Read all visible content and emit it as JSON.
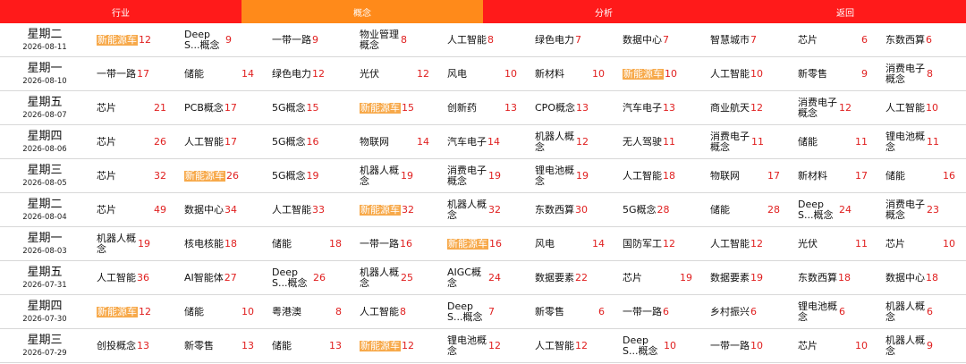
{
  "tabs": [
    {
      "label": "行业",
      "active": false
    },
    {
      "label": "概念",
      "active": true
    },
    {
      "label": "分析",
      "active": false
    },
    {
      "label": "返回",
      "active": false
    }
  ],
  "colors": {
    "tab_bg": "#ff1a1a",
    "tab_active": "#ff8a1a",
    "highlight": "#f7a94a",
    "count": "#e02020"
  },
  "rows": [
    {
      "weekday": "星期二",
      "date": "2026-08-11",
      "items": [
        {
          "name": "新能源车",
          "count": "12",
          "hl": true
        },
        {
          "name": "DeepS...概念",
          "count": "9"
        },
        {
          "name": "一带一路",
          "count": "9"
        },
        {
          "name": "物业管理概念",
          "count": "8"
        },
        {
          "name": "人工智能",
          "count": "8"
        },
        {
          "name": "绿色电力",
          "count": "7"
        },
        {
          "name": "数据中心",
          "count": "7"
        },
        {
          "name": "智慧城市",
          "count": "7"
        },
        {
          "name": "芯片",
          "count": "6"
        },
        {
          "name": "东数西算",
          "count": "6"
        }
      ]
    },
    {
      "weekday": "星期一",
      "date": "2026-08-10",
      "items": [
        {
          "name": "一带一路",
          "count": "17"
        },
        {
          "name": "储能",
          "count": "14"
        },
        {
          "name": "绿色电力",
          "count": "12"
        },
        {
          "name": "光伏",
          "count": "12"
        },
        {
          "name": "风电",
          "count": "10"
        },
        {
          "name": "新材料",
          "count": "10"
        },
        {
          "name": "新能源车",
          "count": "10",
          "hl": true
        },
        {
          "name": "人工智能",
          "count": "10"
        },
        {
          "name": "新零售",
          "count": "9"
        },
        {
          "name": "消费电子概念",
          "count": "8"
        }
      ]
    },
    {
      "weekday": "星期五",
      "date": "2026-08-07",
      "items": [
        {
          "name": "芯片",
          "count": "21"
        },
        {
          "name": "PCB概念",
          "count": "17"
        },
        {
          "name": "5G概念",
          "count": "15"
        },
        {
          "name": "新能源车",
          "count": "15",
          "hl": true
        },
        {
          "name": "创新药",
          "count": "13"
        },
        {
          "name": "CPO概念",
          "count": "13"
        },
        {
          "name": "汽车电子",
          "count": "13"
        },
        {
          "name": "商业航天",
          "count": "12"
        },
        {
          "name": "消费电子概念",
          "count": "12"
        },
        {
          "name": "人工智能",
          "count": "10"
        }
      ]
    },
    {
      "weekday": "星期四",
      "date": "2026-08-06",
      "items": [
        {
          "name": "芯片",
          "count": "26"
        },
        {
          "name": "人工智能",
          "count": "17"
        },
        {
          "name": "5G概念",
          "count": "16"
        },
        {
          "name": "物联网",
          "count": "14"
        },
        {
          "name": "汽车电子",
          "count": "14"
        },
        {
          "name": "机器人概念",
          "count": "12"
        },
        {
          "name": "无人驾驶",
          "count": "11"
        },
        {
          "name": "消费电子概念",
          "count": "11"
        },
        {
          "name": "储能",
          "count": "11"
        },
        {
          "name": "锂电池概念",
          "count": "11"
        }
      ]
    },
    {
      "weekday": "星期三",
      "date": "2026-08-05",
      "items": [
        {
          "name": "芯片",
          "count": "32"
        },
        {
          "name": "新能源车",
          "count": "26",
          "hl": true
        },
        {
          "name": "5G概念",
          "count": "19"
        },
        {
          "name": "机器人概念",
          "count": "19"
        },
        {
          "name": "消费电子概念",
          "count": "19"
        },
        {
          "name": "锂电池概念",
          "count": "19"
        },
        {
          "name": "人工智能",
          "count": "18"
        },
        {
          "name": "物联网",
          "count": "17"
        },
        {
          "name": "新材料",
          "count": "17"
        },
        {
          "name": "储能",
          "count": "16"
        }
      ]
    },
    {
      "weekday": "星期二",
      "date": "2026-08-04",
      "items": [
        {
          "name": "芯片",
          "count": "49"
        },
        {
          "name": "数据中心",
          "count": "34"
        },
        {
          "name": "人工智能",
          "count": "33"
        },
        {
          "name": "新能源车",
          "count": "32",
          "hl": true
        },
        {
          "name": "机器人概念",
          "count": "32"
        },
        {
          "name": "东数西算",
          "count": "30"
        },
        {
          "name": "5G概念",
          "count": "28"
        },
        {
          "name": "储能",
          "count": "28"
        },
        {
          "name": "DeepS...概念",
          "count": "24"
        },
        {
          "name": "消费电子概念",
          "count": "23"
        }
      ]
    },
    {
      "weekday": "星期一",
      "date": "2026-08-03",
      "items": [
        {
          "name": "机器人概念",
          "count": "19"
        },
        {
          "name": "核电核能",
          "count": "18"
        },
        {
          "name": "储能",
          "count": "18"
        },
        {
          "name": "一带一路",
          "count": "16"
        },
        {
          "name": "新能源车",
          "count": "16",
          "hl": true
        },
        {
          "name": "风电",
          "count": "14"
        },
        {
          "name": "国防军工",
          "count": "12"
        },
        {
          "name": "人工智能",
          "count": "12"
        },
        {
          "name": "光伏",
          "count": "11"
        },
        {
          "name": "芯片",
          "count": "10"
        }
      ]
    },
    {
      "weekday": "星期五",
      "date": "2026-07-31",
      "items": [
        {
          "name": "人工智能",
          "count": "36"
        },
        {
          "name": "AI智能体",
          "count": "27"
        },
        {
          "name": "DeepS...概念",
          "count": "26"
        },
        {
          "name": "机器人概念",
          "count": "25"
        },
        {
          "name": "AIGC概念",
          "count": "24"
        },
        {
          "name": "数据要素",
          "count": "22"
        },
        {
          "name": "芯片",
          "count": "19"
        },
        {
          "name": "数据要素",
          "count": "19"
        },
        {
          "name": "东数西算",
          "count": "18"
        },
        {
          "name": "数据中心",
          "count": "18"
        }
      ]
    },
    {
      "weekday": "星期四",
      "date": "2026-07-30",
      "items": [
        {
          "name": "新能源车",
          "count": "12",
          "hl": true
        },
        {
          "name": "储能",
          "count": "10"
        },
        {
          "name": "粤港澳",
          "count": "8"
        },
        {
          "name": "人工智能",
          "count": "8"
        },
        {
          "name": "DeepS...概念",
          "count": "7"
        },
        {
          "name": "新零售",
          "count": "6"
        },
        {
          "name": "一带一路",
          "count": "6"
        },
        {
          "name": "乡村振兴",
          "count": "6"
        },
        {
          "name": "锂电池概念",
          "count": "6"
        },
        {
          "name": "机器人概念",
          "count": "6"
        }
      ]
    },
    {
      "weekday": "星期三",
      "date": "2026-07-29",
      "items": [
        {
          "name": "创投概念",
          "count": "13"
        },
        {
          "name": "新零售",
          "count": "13"
        },
        {
          "name": "储能",
          "count": "13"
        },
        {
          "name": "新能源车",
          "count": "12",
          "hl": true
        },
        {
          "name": "锂电池概念",
          "count": "12"
        },
        {
          "name": "人工智能",
          "count": "12"
        },
        {
          "name": "DeepS...概念",
          "count": "10"
        },
        {
          "name": "一带一路",
          "count": "10"
        },
        {
          "name": "芯片",
          "count": "10"
        },
        {
          "name": "机器人概念",
          "count": "9"
        }
      ]
    }
  ]
}
